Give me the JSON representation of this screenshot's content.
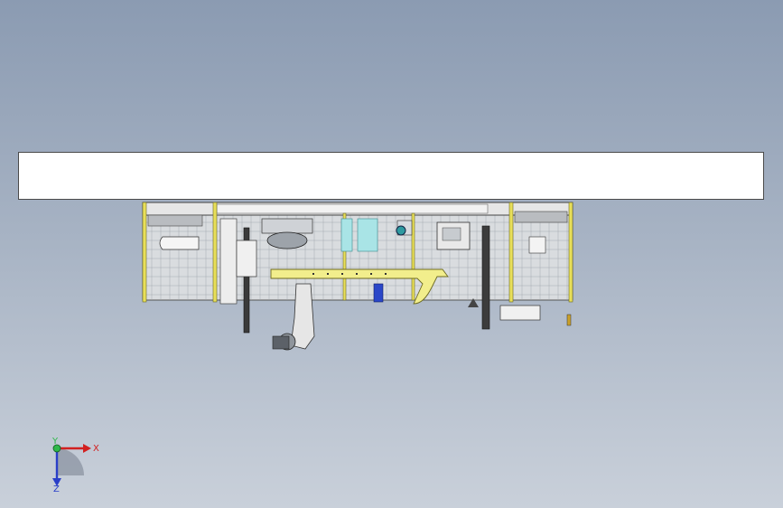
{
  "banner": {
    "text": ""
  },
  "triad": {
    "x_label": "X",
    "y_label": "Y",
    "z_label": "Z"
  },
  "colors": {
    "background_top": "#8b9bb2",
    "background_bottom": "#c9d0da",
    "frame_yellow": "#e8df5a",
    "beam_yellow": "#f2ee8c",
    "accent_blue": "#2a46c8",
    "x_axis": "#d22020",
    "y_axis": "#2fb84a",
    "z_axis": "#2a3fc8"
  }
}
